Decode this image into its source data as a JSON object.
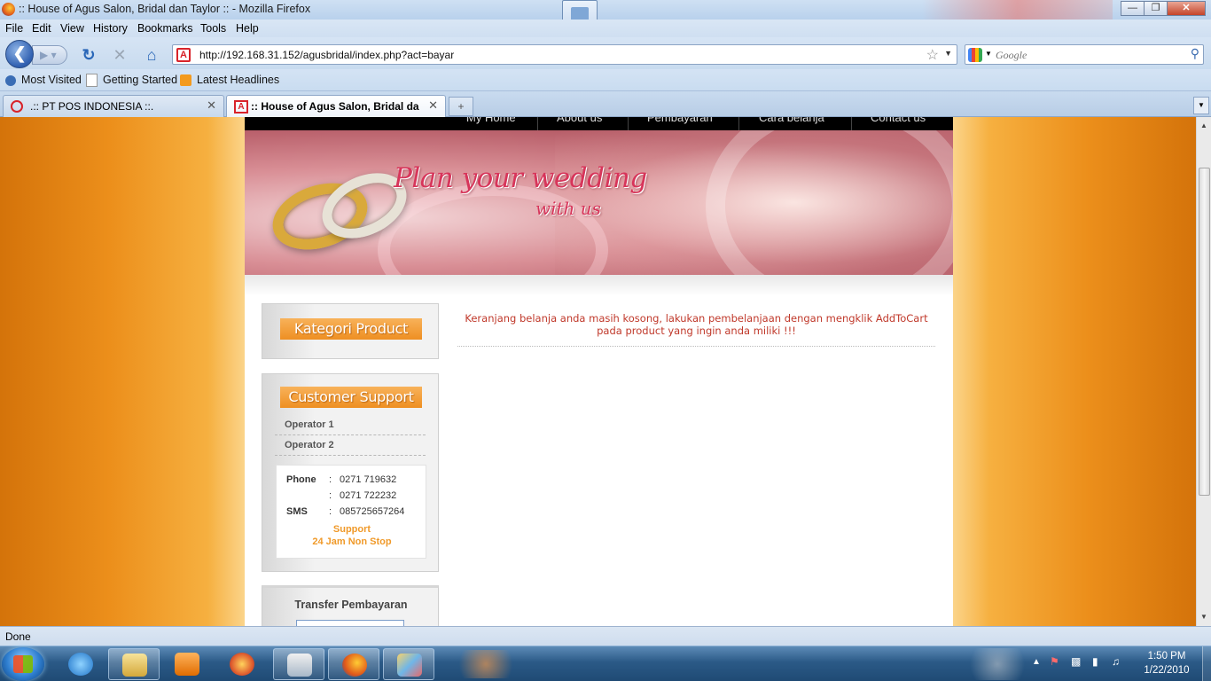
{
  "window": {
    "title": ":: House of Agus Salon, Bridal dan Taylor :: - Mozilla Firefox",
    "controls": [
      "minimize",
      "maximize",
      "close"
    ]
  },
  "menu": [
    "File",
    "Edit",
    "View",
    "History",
    "Bookmarks",
    "Tools",
    "Help"
  ],
  "navbar": {
    "url": "http://192.168.31.152/agusbridal/index.php?act=bayar",
    "search_placeholder": "Google"
  },
  "bookmarks": [
    "Most Visited",
    "Getting Started",
    "Latest Headlines"
  ],
  "tabs": [
    {
      "label": ".:: PT POS INDONESIA ::.",
      "active": false
    },
    {
      "label": ":: House of Agus Salon, Bridal dan ...",
      "active": true
    }
  ],
  "site": {
    "nav": [
      "My Home",
      "About us",
      "Pembayaran",
      "Cara belanja",
      "Contact us"
    ],
    "banner": {
      "line1": "Plan your wedding",
      "line2": "with us"
    },
    "kategori_title": "Kategori Product",
    "support": {
      "title": "Customer Support",
      "operators": [
        "Operator 1",
        "Operator 2"
      ],
      "contacts": [
        {
          "label": "Phone",
          "sep": ":",
          "value": "0271 719632"
        },
        {
          "label": "",
          "sep": ":",
          "value": "0271 722232"
        },
        {
          "label": "SMS",
          "sep": ":",
          "value": "085725657264"
        }
      ],
      "support_line1": "Support",
      "support_line2": "24 Jam Non Stop"
    },
    "transfer_title": "Transfer Pembayaran",
    "message": "Keranjang belanja anda masih kosong, lakukan pembelanjaan dengan mengklik AddToCart pada product yang ingin anda miliki !!!"
  },
  "status": "Done",
  "clock": {
    "time": "1:50 PM",
    "date": "1/22/2010"
  }
}
